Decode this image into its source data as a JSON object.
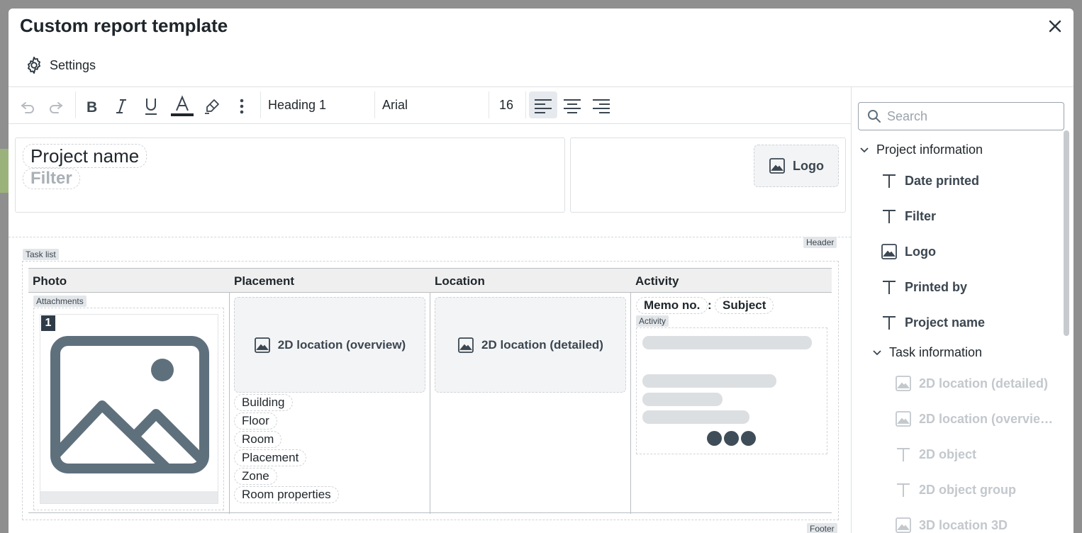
{
  "dialog": {
    "title": "Custom report template"
  },
  "tabs": {
    "settings_label": "Settings"
  },
  "toolbar": {
    "style_value": "Heading 1",
    "font_value": "Arial",
    "size_value": "16"
  },
  "header_section": {
    "project_name_chip": "Project name",
    "filter_chip": "Filter",
    "logo_label": "Logo",
    "section_tag": "Header"
  },
  "task_list": {
    "tag": "Task list",
    "columns": [
      "Photo",
      "Placement",
      "Location",
      "Activity"
    ],
    "attachments_tag": "Attachments",
    "photo_badge": "1",
    "overview_label": "2D location (overview)",
    "detailed_label": "2D location (detailed)",
    "placement_fields": [
      "Building",
      "Floor",
      "Room",
      "Placement",
      "Zone",
      "Room properties"
    ],
    "memo_label": "Memo no.",
    "memo_separator": ":",
    "subject_label": "Subject",
    "activity_tag": "Activity"
  },
  "footer_section": {
    "tag": "Footer"
  },
  "sidebar": {
    "search_placeholder": "Search",
    "group_project": "Project information",
    "project_items": [
      {
        "label": "Date printed",
        "icon": "text-icon"
      },
      {
        "label": "Filter",
        "icon": "text-icon"
      },
      {
        "label": "Logo",
        "icon": "image-icon"
      },
      {
        "label": "Printed by",
        "icon": "text-icon"
      },
      {
        "label": "Project name",
        "icon": "text-icon"
      }
    ],
    "group_task": "Task information",
    "task_items": [
      {
        "label": "2D location (detailed)",
        "icon": "image-icon"
      },
      {
        "label": "2D location (overvie…",
        "icon": "image-icon"
      },
      {
        "label": "2D object",
        "icon": "text-icon"
      },
      {
        "label": "2D object group",
        "icon": "text-icon"
      },
      {
        "label": "3D location 3D",
        "icon": "image-icon"
      }
    ]
  }
}
